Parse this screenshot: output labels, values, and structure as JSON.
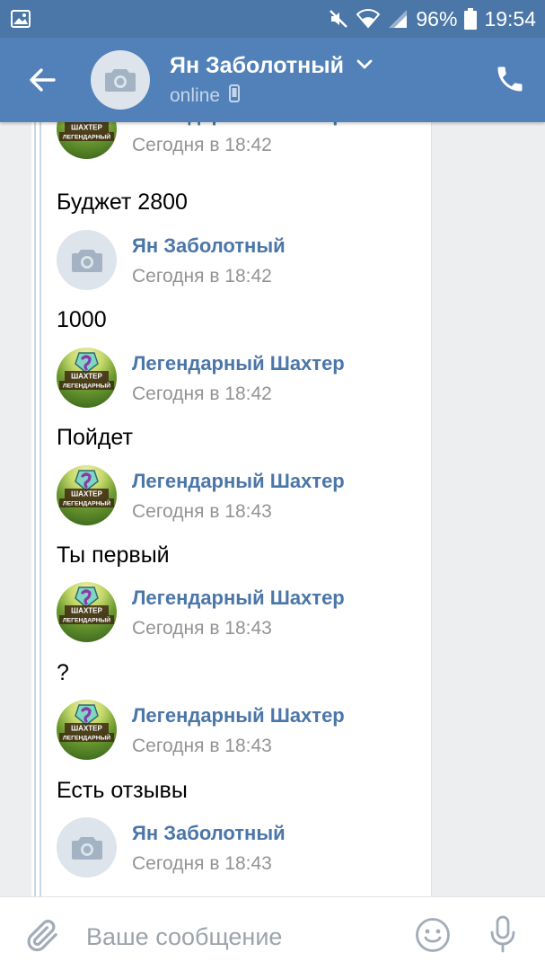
{
  "status_bar": {
    "battery": "96%",
    "time": "19:54"
  },
  "header": {
    "contact_name": "Ян Заболотный",
    "status": "online"
  },
  "messages": [
    {
      "sender": "Легендарный Шахтер",
      "time": "Сегодня в 18:42",
      "text": "Буджет 2800",
      "avatar": "photo"
    },
    {
      "sender": "Ян Заболотный",
      "time": "Сегодня в 18:42",
      "text": "1000",
      "avatar": "camera"
    },
    {
      "sender": "Легендарный Шахтер",
      "time": "Сегодня в 18:42",
      "text": "Пойдет",
      "avatar": "photo"
    },
    {
      "sender": "Легендарный Шахтер",
      "time": "Сегодня в 18:43",
      "text": "Ты первый",
      "avatar": "photo"
    },
    {
      "sender": "Легендарный Шахтер",
      "time": "Сегодня в 18:43",
      "text": "?",
      "avatar": "photo"
    },
    {
      "sender": "Легендарный Шахтер",
      "time": "Сегодня в 18:43",
      "text": "Есть отзывы",
      "avatar": "photo"
    },
    {
      "sender": "Ян Заболотный",
      "time": "Сегодня в 18:43",
      "text": "",
      "avatar": "camera"
    }
  ],
  "avatar_badge": {
    "line1": "ШАХТЕР",
    "line2": "ЛЕГЕНДАРНЫЙ"
  },
  "composer": {
    "placeholder": "Ваше сообщение"
  },
  "icons": {
    "gallery": "image-icon",
    "mute": "mute-icon",
    "wifi": "wifi-icon",
    "signal": "signal-icon",
    "battery": "battery-icon",
    "back": "arrow-left-icon",
    "chevron": "chevron-down-icon",
    "mobile": "mobile-icon",
    "call": "phone-icon",
    "attach": "paperclip-icon",
    "emoji": "smile-icon",
    "mic": "microphone-icon",
    "camera": "camera-icon"
  },
  "colors": {
    "header": "#5181b8",
    "status_bar": "#4a76a8",
    "sender_name": "#4a76a8",
    "timestamp": "#939393",
    "chat_background": "#edeef0"
  }
}
